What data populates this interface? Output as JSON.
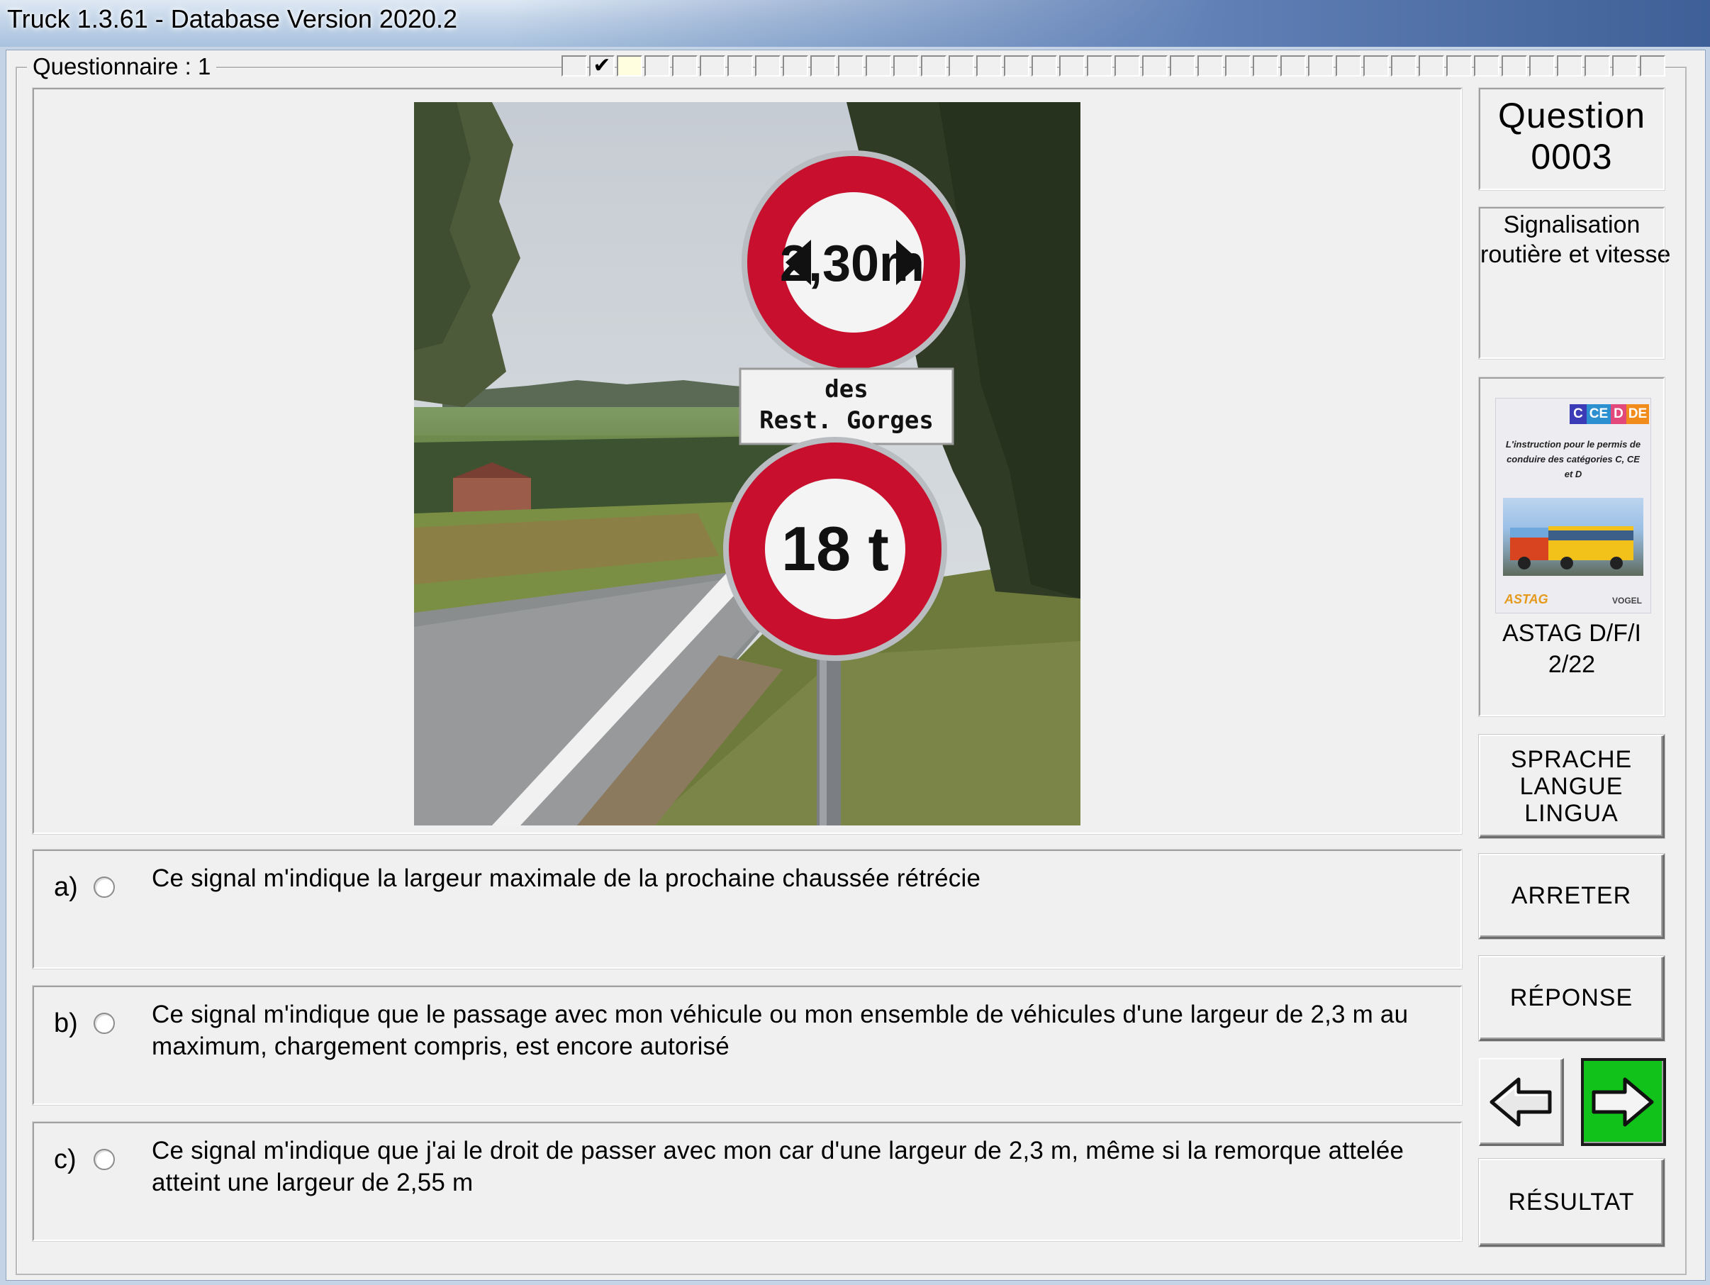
{
  "window": {
    "title": "Truck 1.3.61 - Database Version 2020.2"
  },
  "questionnaire": {
    "label": "Questionnaire : 1",
    "progress_cells": 40,
    "answered_cells": [
      1
    ],
    "current_cell": 2
  },
  "photo": {
    "sign_top_text": "2,30m",
    "plate_line1": "des",
    "plate_line2": "Rest.  Gorges",
    "sign_bottom_text": "18 t"
  },
  "answers": [
    {
      "letter": "a)",
      "text": "Ce signal m'indique la largeur maximale de la prochaine chaussée rétrécie"
    },
    {
      "letter": "b)",
      "text": "Ce signal m'indique que le passage avec mon véhicule ou mon ensemble de véhicules d'une largeur de 2,3 m au maximum, chargement compris, est encore autorisé"
    },
    {
      "letter": "c)",
      "text": "Ce signal m'indique que j'ai le droit de passer avec mon car d'une largeur de 2,3 m, même si la remorque attelée atteint une largeur de 2,55 m"
    }
  ],
  "sidebar": {
    "question_label": "Question",
    "question_number": "0003",
    "category_line1": "Signalisation",
    "category_line2": "routière et vitesse",
    "book": {
      "tag_c": "C",
      "tag_ce": "CE",
      "tag_d": "D",
      "tag_de": "DE",
      "cover_text": "L'instruction pour le permis de conduire des catégories C, CE et D",
      "logo_left": "ASTAG",
      "logo_right": "VOGEL",
      "caption1": "ASTAG D/F/I",
      "caption2": "2/22"
    },
    "lang_line1": "SPRACHE",
    "lang_line2": "LANGUE",
    "lang_line3": "LINGUA",
    "stop_label": "ARRETER",
    "answer_label": "RÉPONSE",
    "result_label": "RÉSULTAT"
  },
  "colors": {
    "next_button": "#11c21a",
    "sign_red": "#c8102e",
    "progress_current": "#ffffe0"
  },
  "icons": {
    "prev": "arrow-left-icon",
    "next": "arrow-right-icon",
    "radio": "radio-empty-icon",
    "check": "checkmark-icon"
  }
}
